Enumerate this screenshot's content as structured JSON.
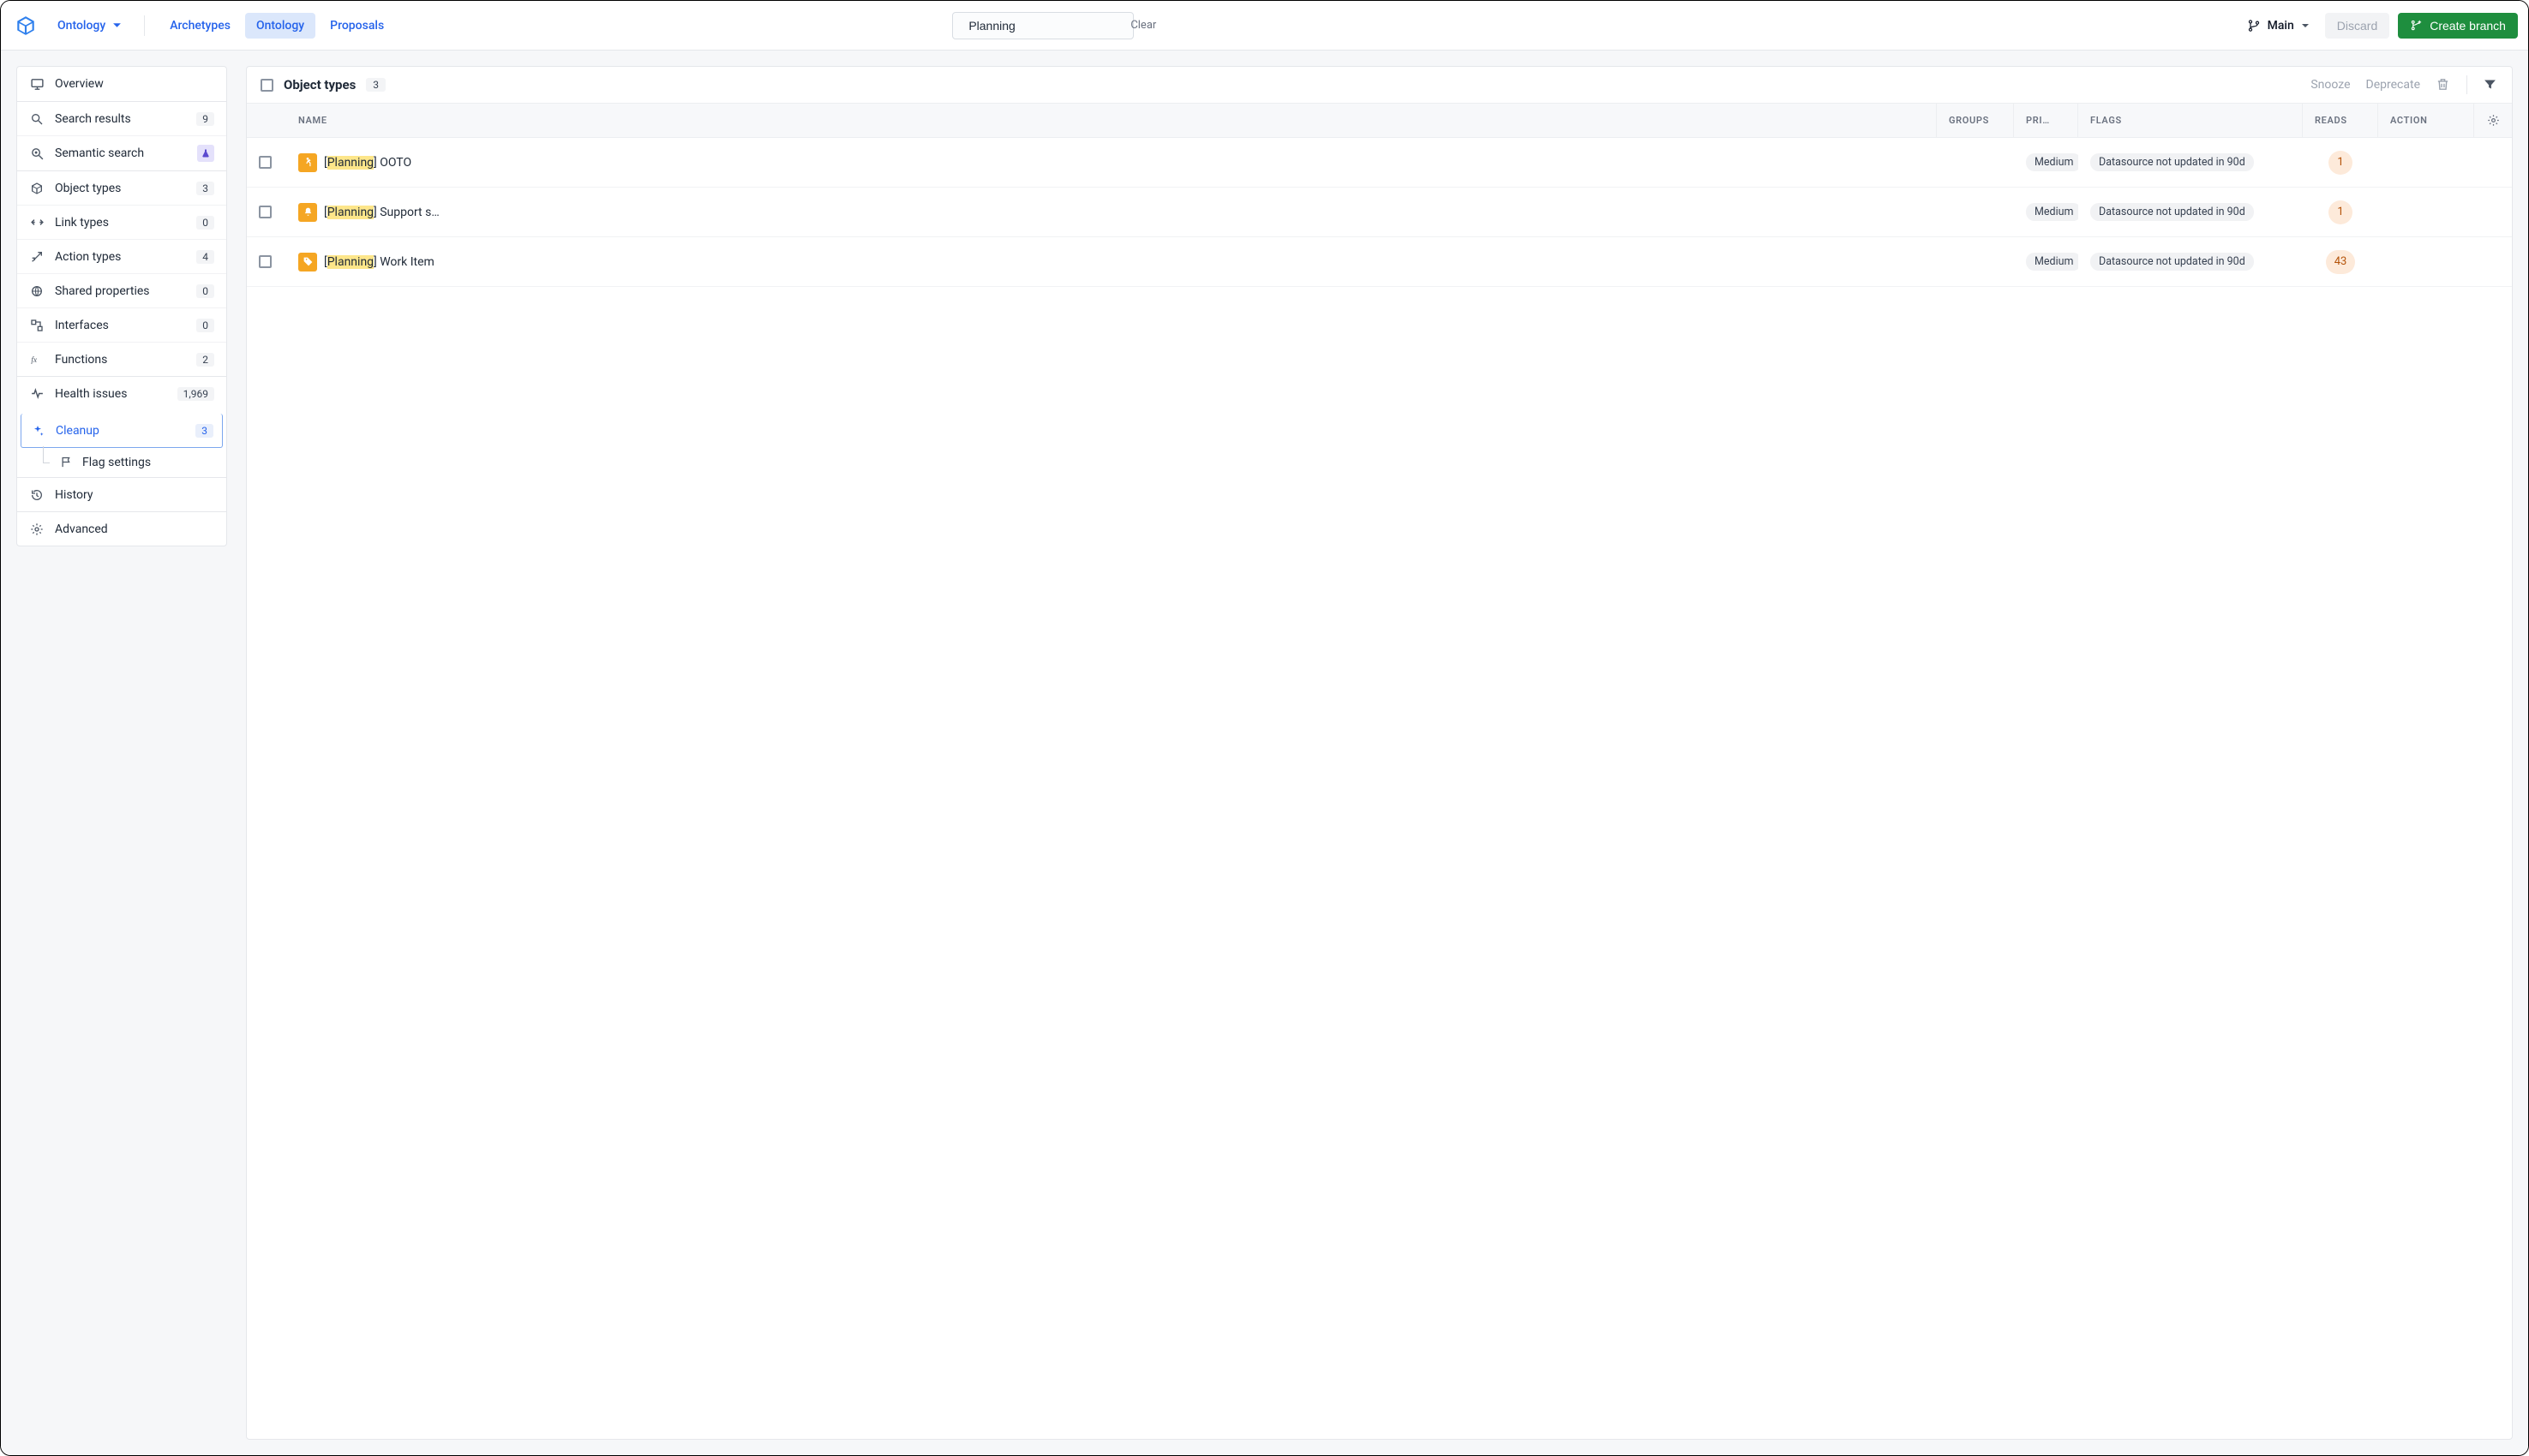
{
  "topbar": {
    "project_label": "Ontology",
    "tabs": [
      {
        "label": "Archetypes",
        "active": false
      },
      {
        "label": "Ontology",
        "active": true
      },
      {
        "label": "Proposals",
        "active": false
      }
    ],
    "search_value": "Planning",
    "clear_label": "Clear",
    "branch_label": "Main",
    "discard_label": "Discard",
    "create_branch_label": "Create branch"
  },
  "sidebar": {
    "groups": [
      [
        {
          "icon": "monitor",
          "label": "Overview"
        }
      ],
      [
        {
          "icon": "search",
          "label": "Search results",
          "count": "9"
        },
        {
          "icon": "semantic",
          "label": "Semantic search",
          "badge": "flask"
        }
      ],
      [
        {
          "icon": "cube",
          "label": "Object types",
          "count": "3"
        },
        {
          "icon": "link",
          "label": "Link types",
          "count": "0"
        },
        {
          "icon": "wand",
          "label": "Action types",
          "count": "4"
        },
        {
          "icon": "globe",
          "label": "Shared properties",
          "count": "0"
        },
        {
          "icon": "interface",
          "label": "Interfaces",
          "count": "0"
        },
        {
          "icon": "fx",
          "label": "Functions",
          "count": "2"
        }
      ],
      [
        {
          "icon": "pulse",
          "label": "Health issues",
          "count": "1,969"
        },
        {
          "icon": "sparkle",
          "label": "Cleanup",
          "count": "3",
          "selected": true,
          "children": [
            {
              "icon": "flag",
              "label": "Flag settings"
            }
          ]
        }
      ],
      [
        {
          "icon": "history",
          "label": "History"
        }
      ],
      [
        {
          "icon": "gear",
          "label": "Advanced"
        }
      ]
    ]
  },
  "main": {
    "title": "Object types",
    "count": "3",
    "actions": {
      "snooze": "Snooze",
      "deprecate": "Deprecate"
    },
    "columns": {
      "name": "NAME",
      "groups": "GROUPS",
      "pri": "PRI…",
      "flags": "FLAGS",
      "reads": "READS",
      "action": "ACTION"
    },
    "rows": [
      {
        "icon": "person",
        "prefix": "Planning",
        "rest": " OOTO",
        "priority": "Medium",
        "flag": "Datasource not updated in 90d",
        "reads": "1"
      },
      {
        "icon": "bell",
        "prefix": "Planning",
        "rest": " Support s…",
        "priority": "Medium",
        "flag": "Datasource not updated in 90d",
        "reads": "1"
      },
      {
        "icon": "tag",
        "prefix": "Planning",
        "rest": " Work Item",
        "priority": "Medium",
        "flag": "Datasource not updated in 90d",
        "reads": "43"
      }
    ]
  }
}
